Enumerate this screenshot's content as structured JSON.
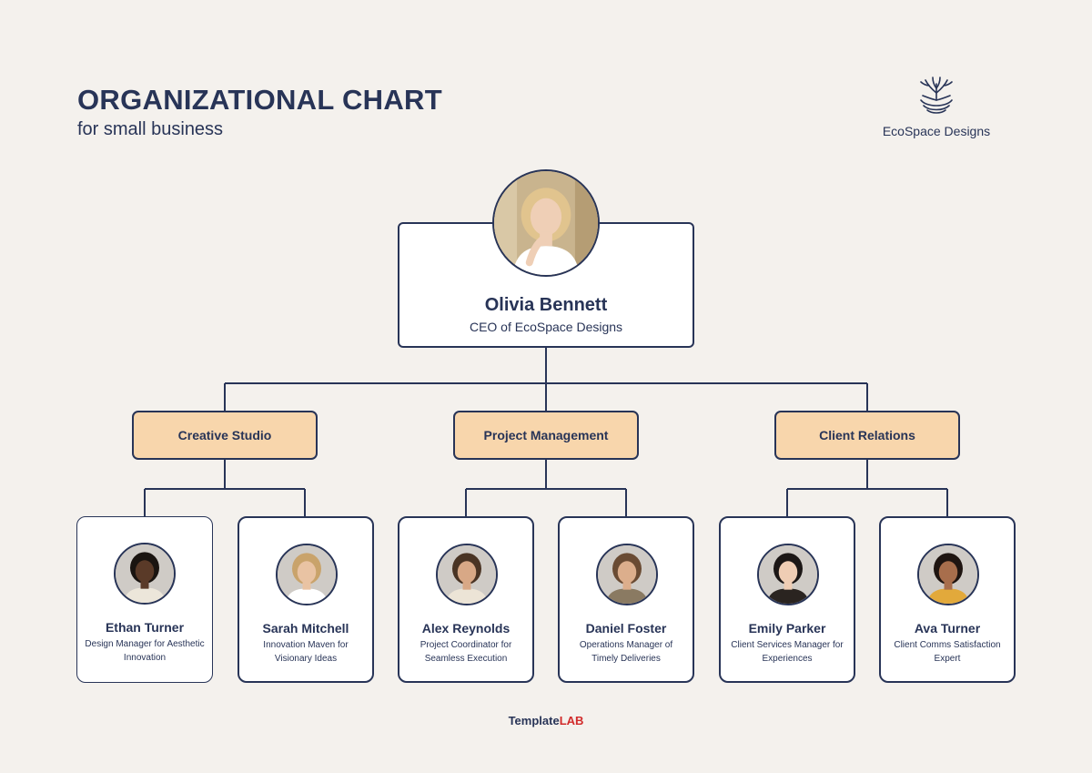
{
  "header": {
    "title": "ORGANIZATIONAL CHART",
    "subtitle": "for small business"
  },
  "logo": {
    "name": "EcoSpace Designs",
    "icon": "tree-icon"
  },
  "ceo": {
    "name": "Olivia Bennett",
    "role": "CEO of EcoSpace Designs"
  },
  "departments": [
    {
      "name": "Creative Studio"
    },
    {
      "name": "Project Management"
    },
    {
      "name": "Client Relations"
    }
  ],
  "employees": [
    {
      "name": "Ethan Turner",
      "role": "Design Manager for Aesthetic Innovation",
      "skin": "#5a3a28",
      "hair": "#1a1410",
      "shirt": "#ece6da"
    },
    {
      "name": "Sarah Mitchell",
      "role": "Innovation Maven for Visionary Ideas",
      "skin": "#e9c3a3",
      "hair": "#c9a36b",
      "shirt": "#ffffff"
    },
    {
      "name": "Alex Reynolds",
      "role": "Project Coordinator for Seamless Execution",
      "skin": "#d8a886",
      "hair": "#4a3424",
      "shirt": "#ece4d6"
    },
    {
      "name": "Daniel Foster",
      "role": "Operations Manager of Timely Deliveries",
      "skin": "#dcae8c",
      "hair": "#6a4b33",
      "shirt": "#8a7a62"
    },
    {
      "name": "Emily Parker",
      "role": "Client Services Manager for Experiences",
      "skin": "#efcdb4",
      "hair": "#1c1716",
      "shirt": "#2a2420"
    },
    {
      "name": "Ava Turner",
      "role": "Client Comms Satisfaction Expert",
      "skin": "#a86e4c",
      "hair": "#1f1511",
      "shirt": "#e2a93b"
    }
  ],
  "ceo_photo": {
    "skin": "#efcfb6",
    "hair": "#e1c48e",
    "shirt": "#ffffff",
    "bg": "#c9b48e"
  },
  "colors": {
    "navy": "#283457",
    "dept_fill": "#f8d6ac",
    "background": "#f4f1ed",
    "brand_red": "#d12a2a"
  },
  "footer": {
    "brand_a": "Template",
    "brand_b": "LAB"
  }
}
